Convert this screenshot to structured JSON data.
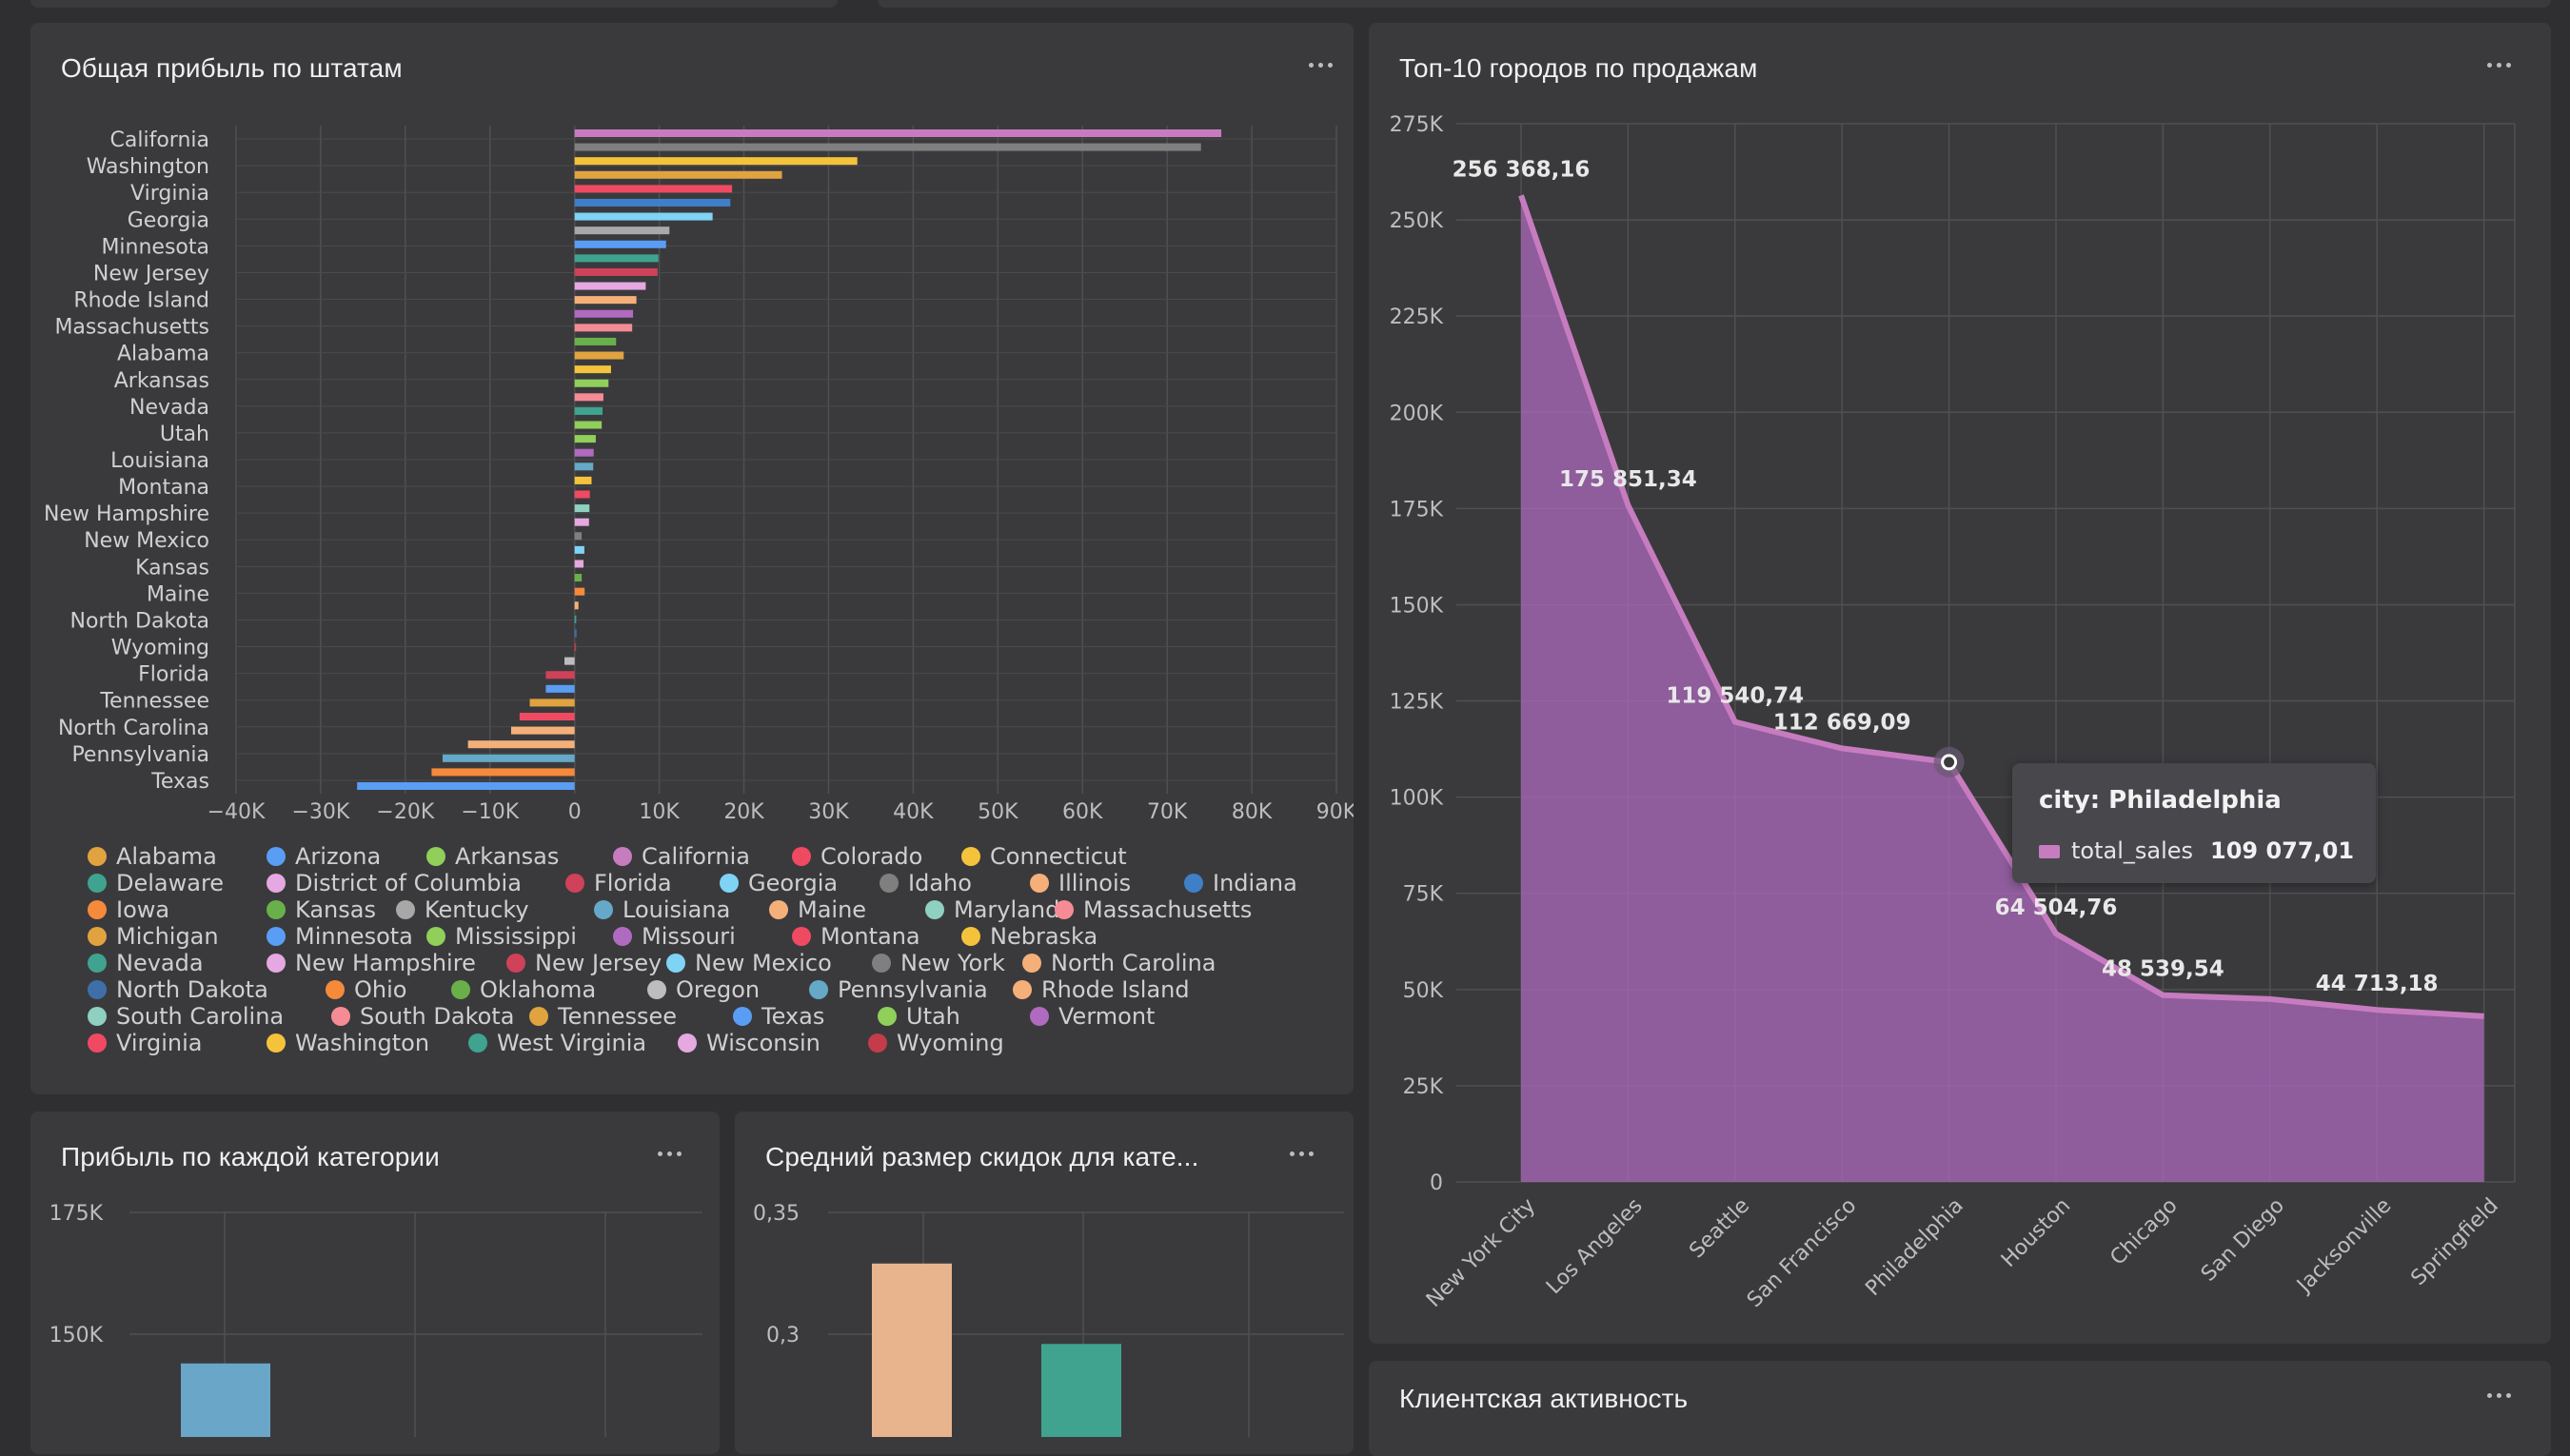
{
  "panels": {
    "state_profit": {
      "title": "Общая прибыль по штатам"
    },
    "top_cities": {
      "title": "Топ-10 городов по продажам"
    },
    "category_profit": {
      "title": "Прибыль по каждой категории"
    },
    "avg_discount": {
      "title": "Средний размер скидок для кате..."
    },
    "client_activity": {
      "title": "Клиентская активность"
    }
  },
  "chart_data": [
    {
      "id": "state_profit",
      "type": "bar",
      "orientation": "horizontal",
      "title": "Общая прибыль по штатам",
      "xlim": [
        -40000,
        90000
      ],
      "x_tick_labels": [
        "−40K",
        "−30K",
        "−20K",
        "−10K",
        "0",
        "10K",
        "20K",
        "30K",
        "40K",
        "50K",
        "60K",
        "70K",
        "80K",
        "90K"
      ],
      "y_tick_labels": [
        "California",
        "Washington",
        "Virginia",
        "Georgia",
        "Minnesota",
        "New Jersey",
        "Rhode Island",
        "Massachusetts",
        "Alabama",
        "Arkansas",
        "Nevada",
        "Utah",
        "Louisiana",
        "Montana",
        "New Hampshire",
        "New Mexico",
        "Kansas",
        "Maine",
        "North Dakota",
        "Wyoming",
        "Florida",
        "Tennessee",
        "North Carolina",
        "Pennsylvania",
        "Texas"
      ],
      "bars": [
        {
          "state": "California",
          "value": 76400,
          "color": "#c77cc0"
        },
        {
          "state": "New York",
          "value": 74000,
          "color": "#7f7f7f"
        },
        {
          "state": "Washington",
          "value": 33400,
          "color": "#f5c33b"
        },
        {
          "state": "Michigan",
          "value": 24500,
          "color": "#e0a33f"
        },
        {
          "state": "Virginia",
          "value": 18600,
          "color": "#f04a63"
        },
        {
          "state": "Indiana",
          "value": 18400,
          "color": "#3f7fc7"
        },
        {
          "state": "Georgia",
          "value": 16300,
          "color": "#7fd3f5"
        },
        {
          "state": "Kentucky",
          "value": 11200,
          "color": "#a8a8a8"
        },
        {
          "state": "Minnesota",
          "value": 10800,
          "color": "#5a9df5"
        },
        {
          "state": "Delaware",
          "value": 9900,
          "color": "#3fa38f"
        },
        {
          "state": "New Jersey",
          "value": 9800,
          "color": "#d0415a"
        },
        {
          "state": "Wisconsin",
          "value": 8400,
          "color": "#e5a8e0"
        },
        {
          "state": "Rhode Island",
          "value": 7300,
          "color": "#f5b07a"
        },
        {
          "state": "Missouri",
          "value": 6900,
          "color": "#b06ac0"
        },
        {
          "state": "Massachusetts",
          "value": 6800,
          "color": "#f58c95"
        },
        {
          "state": "Oklahoma",
          "value": 4900,
          "color": "#6ab04a"
        },
        {
          "state": "Alabama",
          "value": 5800,
          "color": "#e0a33f"
        },
        {
          "state": "Connecticut",
          "value": 4300,
          "color": "#f5c33b"
        },
        {
          "state": "Arkansas",
          "value": 4000,
          "color": "#8fcf5a"
        },
        {
          "state": "South Dakota",
          "value": 3400,
          "color": "#f58c95"
        },
        {
          "state": "Nevada",
          "value": 3300,
          "color": "#3fa38f"
        },
        {
          "state": "Mississippi",
          "value": 3200,
          "color": "#8fcf5a"
        },
        {
          "state": "Utah",
          "value": 2500,
          "color": "#8fcf5a"
        },
        {
          "state": "Vermont",
          "value": 2250,
          "color": "#b06ac0"
        },
        {
          "state": "Louisiana",
          "value": 2200,
          "color": "#66a8c8"
        },
        {
          "state": "Nebraska",
          "value": 2000,
          "color": "#f5c33b"
        },
        {
          "state": "Montana",
          "value": 1800,
          "color": "#f04a63"
        },
        {
          "state": "South Carolina",
          "value": 1750,
          "color": "#8fd0c0"
        },
        {
          "state": "New Hampshire",
          "value": 1700,
          "color": "#e5a8e0"
        },
        {
          "state": "Idaho",
          "value": 830,
          "color": "#7f7f7f"
        },
        {
          "state": "New Mexico",
          "value": 1150,
          "color": "#7fd3f5"
        },
        {
          "state": "District of Columbia",
          "value": 1050,
          "color": "#e5a8e0"
        },
        {
          "state": "Kansas",
          "value": 840,
          "color": "#6ab04a"
        },
        {
          "state": "Iowa",
          "value": 1180,
          "color": "#f58a3b"
        },
        {
          "state": "Maine",
          "value": 450,
          "color": "#f5b07a"
        },
        {
          "state": "West Virginia",
          "value": 190,
          "color": "#3fa38f"
        },
        {
          "state": "North Dakota",
          "value": 230,
          "color": "#3f6fa8"
        },
        {
          "state": "Wyoming",
          "value": 100,
          "color": "#c43b4a"
        },
        {
          "state": "Oregon",
          "value": -1200,
          "color": "#bdbdbd"
        },
        {
          "state": "Florida",
          "value": -3400,
          "color": "#d0415a"
        },
        {
          "state": "Arizona",
          "value": -3400,
          "color": "#5a9df5"
        },
        {
          "state": "Tennessee",
          "value": -5300,
          "color": "#e0a33f"
        },
        {
          "state": "Colorado",
          "value": -6500,
          "color": "#f04a63"
        },
        {
          "state": "North Carolina",
          "value": -7500,
          "color": "#f5b07a"
        },
        {
          "state": "Illinois",
          "value": -12600,
          "color": "#f5b07a"
        },
        {
          "state": "Pennsylvania",
          "value": -15600,
          "color": "#66a8c8"
        },
        {
          "state": "Ohio",
          "value": -16900,
          "color": "#f58a3b"
        },
        {
          "state": "Texas",
          "value": -25700,
          "color": "#5a9df5"
        }
      ],
      "legend": [
        {
          "name": "Alabama",
          "color": "#e0a33f"
        },
        {
          "name": "Arizona",
          "color": "#5a9df5"
        },
        {
          "name": "Arkansas",
          "color": "#8fcf5a"
        },
        {
          "name": "California",
          "color": "#c77cc0"
        },
        {
          "name": "Colorado",
          "color": "#f04a63"
        },
        {
          "name": "Connecticut",
          "color": "#f5c33b"
        },
        {
          "name": "Delaware",
          "color": "#3fa38f"
        },
        {
          "name": "District of Columbia",
          "color": "#e5a8e0"
        },
        {
          "name": "Florida",
          "color": "#d0415a"
        },
        {
          "name": "Georgia",
          "color": "#7fd3f5"
        },
        {
          "name": "Idaho",
          "color": "#7f7f7f"
        },
        {
          "name": "Illinois",
          "color": "#f5b07a"
        },
        {
          "name": "Indiana",
          "color": "#3f7fc7"
        },
        {
          "name": "Iowa",
          "color": "#f58a3b"
        },
        {
          "name": "Kansas",
          "color": "#6ab04a"
        },
        {
          "name": "Kentucky",
          "color": "#a8a8a8"
        },
        {
          "name": "Louisiana",
          "color": "#66a8c8"
        },
        {
          "name": "Maine",
          "color": "#f5b07a"
        },
        {
          "name": "Maryland",
          "color": "#8fd0c0"
        },
        {
          "name": "Massachusetts",
          "color": "#f58c95"
        },
        {
          "name": "Michigan",
          "color": "#e0a33f"
        },
        {
          "name": "Minnesota",
          "color": "#5a9df5"
        },
        {
          "name": "Mississippi",
          "color": "#8fcf5a"
        },
        {
          "name": "Missouri",
          "color": "#b06ac0"
        },
        {
          "name": "Montana",
          "color": "#f04a63"
        },
        {
          "name": "Nebraska",
          "color": "#f5c33b"
        },
        {
          "name": "Nevada",
          "color": "#3fa38f"
        },
        {
          "name": "New Hampshire",
          "color": "#e5a8e0"
        },
        {
          "name": "New Jersey",
          "color": "#d0415a"
        },
        {
          "name": "New Mexico",
          "color": "#7fd3f5"
        },
        {
          "name": "New York",
          "color": "#7f7f7f"
        },
        {
          "name": "North Carolina",
          "color": "#f5b07a"
        },
        {
          "name": "North Dakota",
          "color": "#3f6fa8"
        },
        {
          "name": "Ohio",
          "color": "#f58a3b"
        },
        {
          "name": "Oklahoma",
          "color": "#6ab04a"
        },
        {
          "name": "Oregon",
          "color": "#bdbdbd"
        },
        {
          "name": "Pennsylvania",
          "color": "#66a8c8"
        },
        {
          "name": "Rhode Island",
          "color": "#f5b07a"
        },
        {
          "name": "South Carolina",
          "color": "#8fd0c0"
        },
        {
          "name": "South Dakota",
          "color": "#f58c95"
        },
        {
          "name": "Tennessee",
          "color": "#e0a33f"
        },
        {
          "name": "Texas",
          "color": "#5a9df5"
        },
        {
          "name": "Utah",
          "color": "#8fcf5a"
        },
        {
          "name": "Vermont",
          "color": "#b06ac0"
        },
        {
          "name": "Virginia",
          "color": "#f04a63"
        },
        {
          "name": "Washington",
          "color": "#f5c33b"
        },
        {
          "name": "West Virginia",
          "color": "#3fa38f"
        },
        {
          "name": "Wisconsin",
          "color": "#e5a8e0"
        },
        {
          "name": "Wyoming",
          "color": "#c43b4a"
        }
      ],
      "grid": true
    },
    {
      "id": "top_cities",
      "type": "area",
      "title": "Топ-10 городов по продажам",
      "categories": [
        "New York City",
        "Los Angeles",
        "Seattle",
        "San Francisco",
        "Philadelphia",
        "Houston",
        "Chicago",
        "San Diego",
        "Jacksonville",
        "Springfield"
      ],
      "series": [
        {
          "name": "total_sales",
          "color": "#b06ac0",
          "values": [
            256368.16,
            175851.34,
            119540.74,
            112669.09,
            109077.01,
            64504.76,
            48539.54,
            47521.03,
            44713.18,
            43054.34
          ]
        }
      ],
      "data_labels": [
        "256 368,16",
        "175 851,34",
        "119 540,74",
        "112 669,09",
        "",
        "64 504,76",
        "48 539,54",
        "",
        "44 713,18",
        ""
      ],
      "ylim": [
        0,
        275000
      ],
      "y_tick_labels": [
        "0",
        "25K",
        "50K",
        "75K",
        "100K",
        "125K",
        "150K",
        "175K",
        "200K",
        "225K",
        "250K",
        "275K"
      ],
      "grid": true,
      "tooltip": {
        "header": "city: Philadelphia",
        "series": "total_sales",
        "value": "109 077,01",
        "category_index": 4
      }
    },
    {
      "id": "category_profit",
      "type": "bar",
      "title": "Прибыль по каждой категории",
      "y_tick_labels": [
        "175K",
        "150K"
      ],
      "ylim_visible": [
        0,
        175000
      ],
      "bars_visible": [
        {
          "value": 144000,
          "color": "#6aa6c8"
        }
      ]
    },
    {
      "id": "avg_discount",
      "type": "bar",
      "title": "Средний размер скидок для кате...",
      "y_tick_labels": [
        "0,35",
        "0,3"
      ],
      "ylim_visible": [
        0.25,
        0.35
      ],
      "bars_visible": [
        {
          "value": 0.329,
          "color": "#e8b48e"
        },
        {
          "value": 0.296,
          "color": "#3fa38f"
        }
      ]
    }
  ]
}
